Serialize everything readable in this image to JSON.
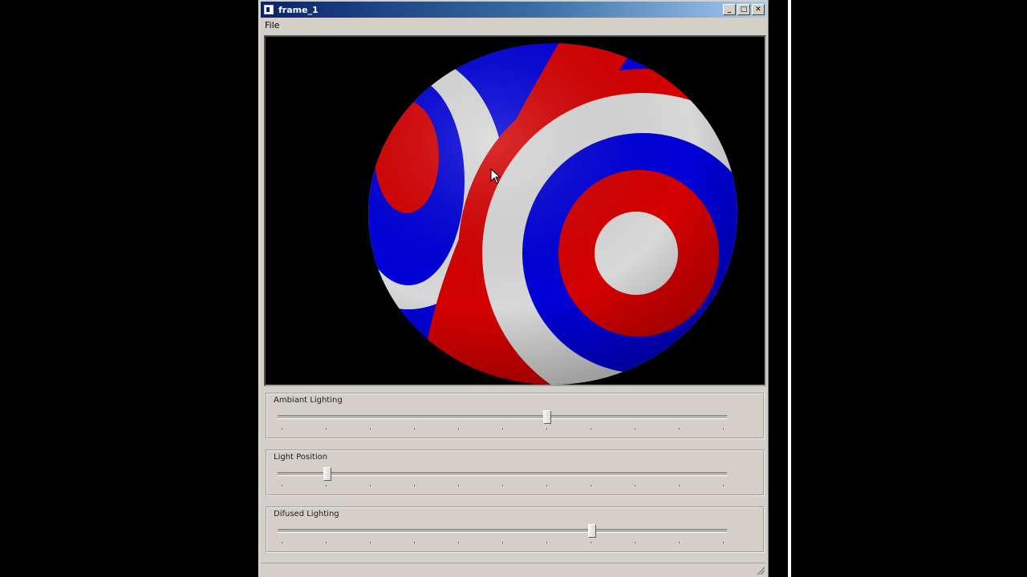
{
  "window": {
    "title": "frame_1",
    "buttons": {
      "minimize": "_",
      "maximize": "□",
      "close": "✕"
    }
  },
  "menu": [
    "File"
  ],
  "sliders": [
    {
      "label": "Ambiant Lighting",
      "value": 0.6,
      "ticks": 11
    },
    {
      "label": "Light Position",
      "value": 0.11,
      "ticks": 11
    },
    {
      "label": "Difused Lighting",
      "value": 0.7,
      "ticks": 11
    }
  ],
  "colors": {
    "sphere_blue": "#0000d8",
    "sphere_red": "#d40000",
    "sphere_white": "#d8d8d8",
    "titlebar_start": "#0a246a",
    "titlebar_end": "#a6caf0",
    "window_bg": "#d4d0c8"
  },
  "icons": [
    "app-icon",
    "minimize-icon",
    "maximize-icon",
    "close-icon",
    "cursor-arrow-icon",
    "resize-grip-icon"
  ]
}
